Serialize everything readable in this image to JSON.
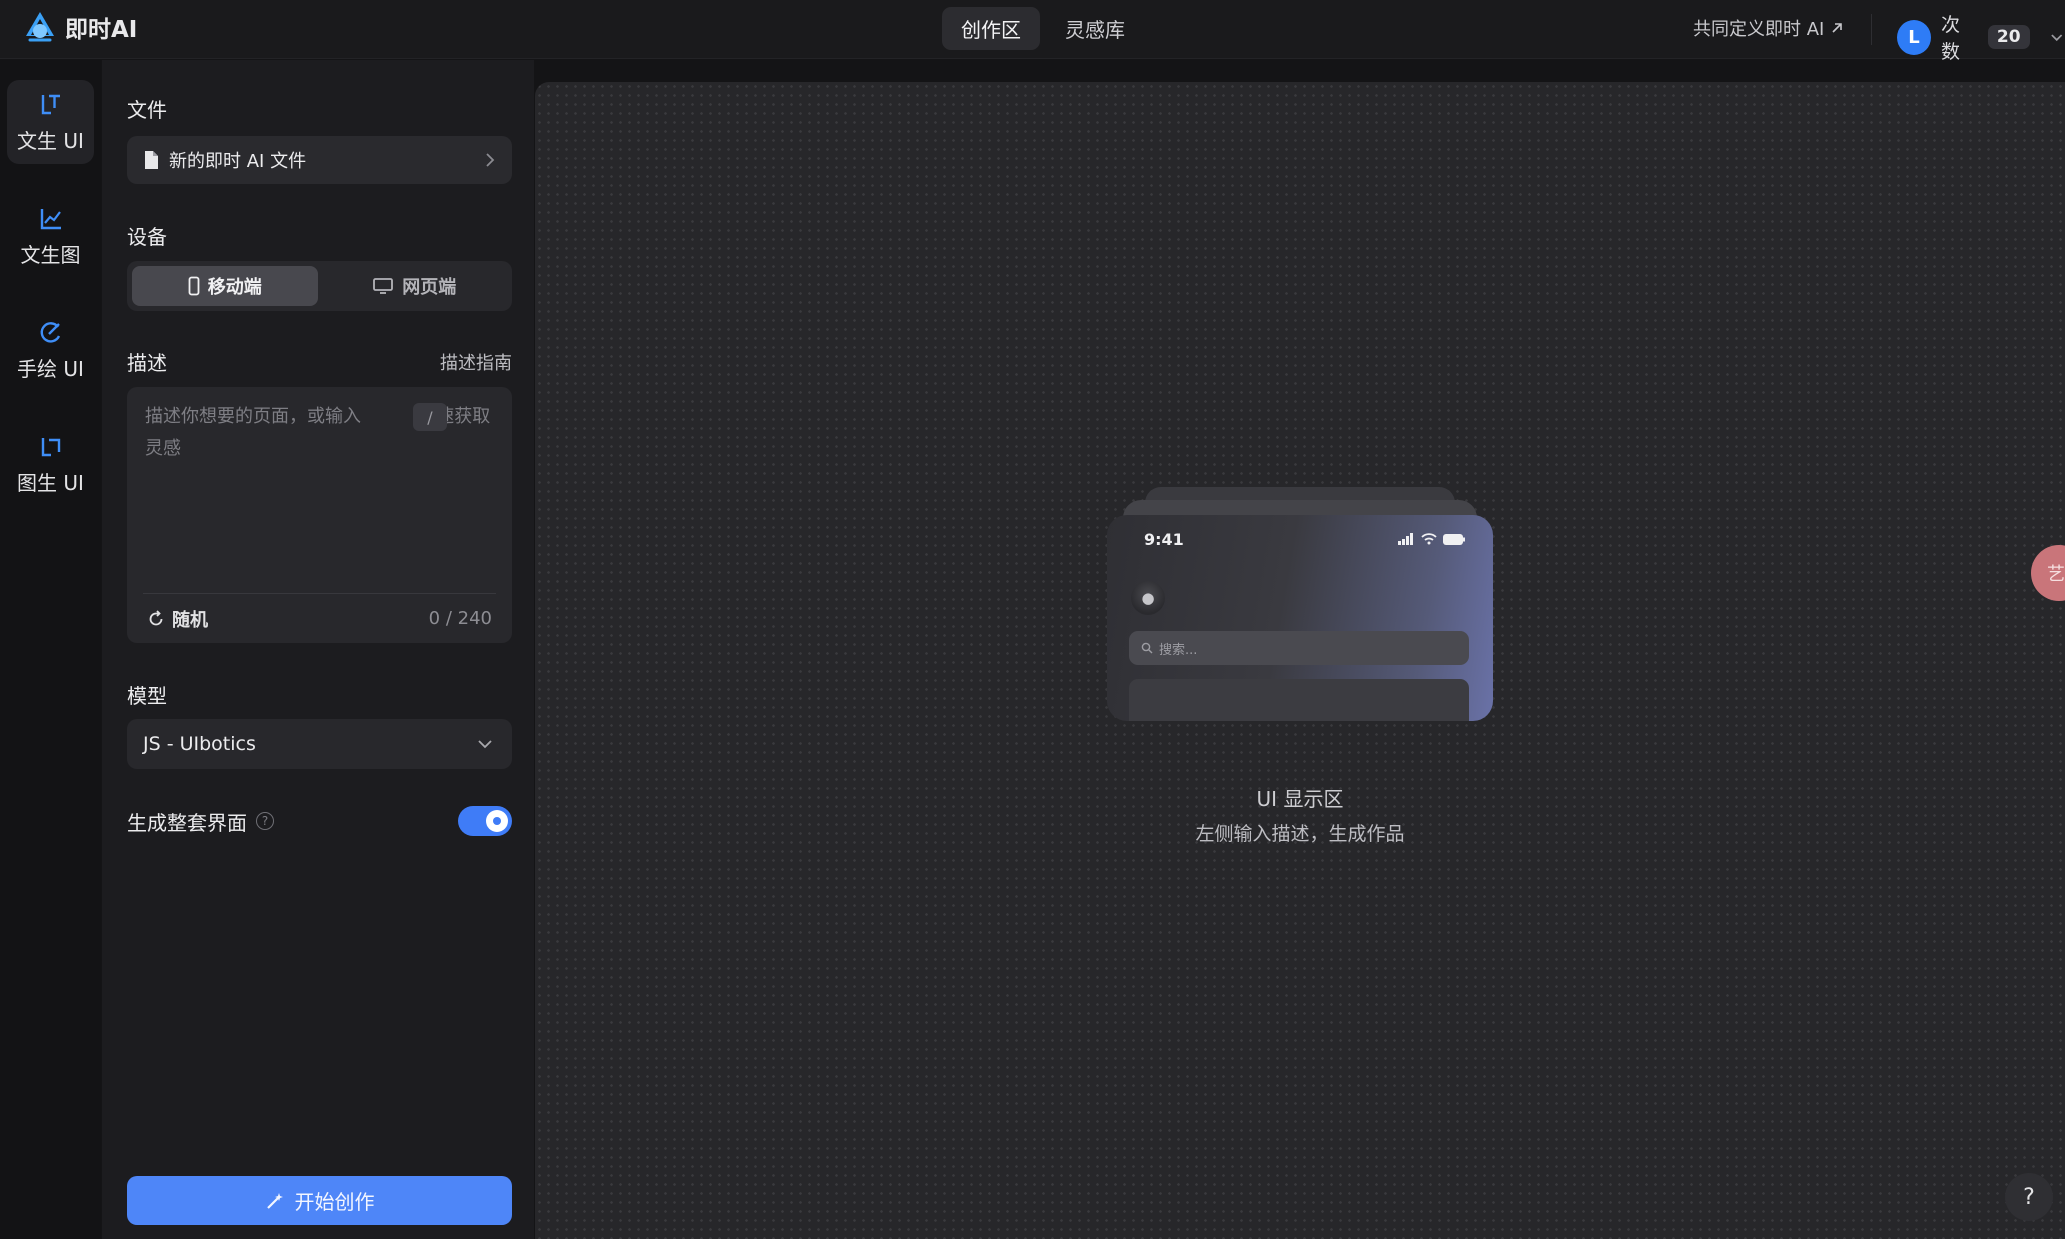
{
  "app": {
    "name": "即时AI",
    "accent": "#3f7cf7"
  },
  "header": {
    "tabs": [
      {
        "label": "创作区",
        "active": true
      },
      {
        "label": "灵感库",
        "active": false
      }
    ],
    "cocreate_link": "共同定义即时 AI",
    "user_initial": "L",
    "count_label": "次数",
    "count_value": "20"
  },
  "rail": {
    "items": [
      {
        "label": "文生 UI",
        "icon": "text-ui-icon",
        "active": true
      },
      {
        "label": "文生图",
        "icon": "chart-icon",
        "active": false
      },
      {
        "label": "手绘 UI",
        "icon": "sketch-icon",
        "active": false
      },
      {
        "label": "图生 UI",
        "icon": "image-ui-icon",
        "active": false
      }
    ]
  },
  "panel": {
    "file_title": "文件",
    "file_name": "新的即时 AI 文件",
    "device_title": "设备",
    "devices": [
      {
        "label": "移动端",
        "icon": "mobile-icon",
        "active": true
      },
      {
        "label": "网页端",
        "icon": "desktop-icon",
        "active": false
      }
    ],
    "desc_title": "描述",
    "desc_guide": "描述指南",
    "desc_placeholder": "描述你想要的页面，或输入          快速获取灵感",
    "desc_slash": "/",
    "random_label": "随机",
    "char_count": "0 / 240",
    "model_title": "模型",
    "model_value": "JS - UIbotics",
    "fullset_label": "生成整套界面",
    "fullset_enabled": true,
    "help_glyph": "?",
    "start_label": "开始创作"
  },
  "canvas": {
    "phone_time": "9:41",
    "phone_search": "搜索...",
    "empty_title": "UI 显示区",
    "empty_subtitle": "左侧输入描述，生成作品",
    "side_pill_text": "艺",
    "help_button": "?"
  }
}
